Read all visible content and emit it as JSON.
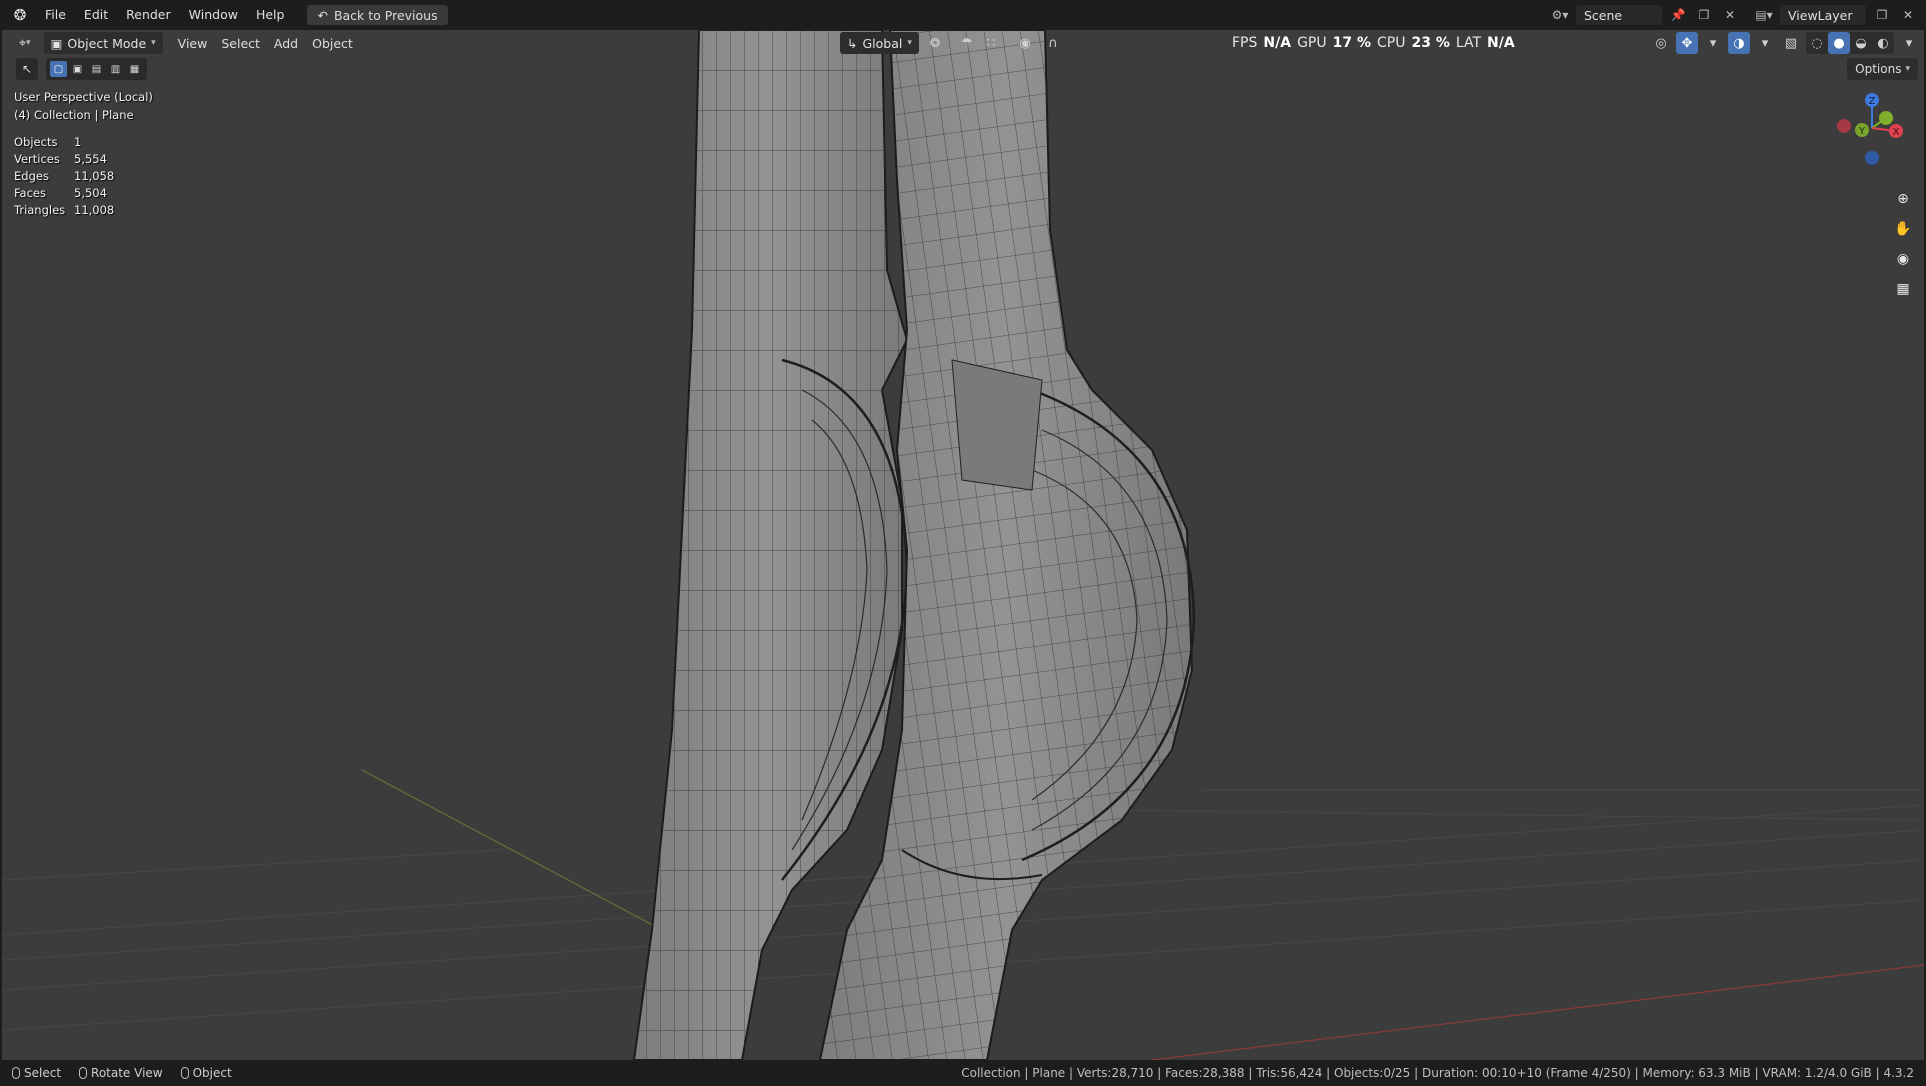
{
  "menu": {
    "items": [
      "File",
      "Edit",
      "Render",
      "Window",
      "Help"
    ],
    "back_button": "Back to Previous"
  },
  "top_right": {
    "scene_label": "Scene",
    "viewlayer_label": "ViewLayer"
  },
  "viewport_header": {
    "mode": "Object Mode",
    "menus": [
      "View",
      "Select",
      "Add",
      "Object"
    ],
    "transform_orientation": "Global",
    "perf": {
      "fps_label": "FPS",
      "fps_value": "N/A",
      "gpu_label": "GPU",
      "gpu_value": "17 %",
      "cpu_label": "CPU",
      "cpu_value": "23 %",
      "lat_label": "LAT",
      "lat_value": "N/A"
    },
    "options_label": "Options"
  },
  "overlay": {
    "view_name": "User Perspective (Local)",
    "collection": "(4) Collection | Plane",
    "stats": [
      {
        "label": "Objects",
        "value": "1"
      },
      {
        "label": "Vertices",
        "value": "5,554"
      },
      {
        "label": "Edges",
        "value": "11,058"
      },
      {
        "label": "Faces",
        "value": "5,504"
      },
      {
        "label": "Triangles",
        "value": "11,008"
      }
    ]
  },
  "gizmo": {
    "z": "Z",
    "y": "Y",
    "x": "X",
    "colors": {
      "x": "#e0424e",
      "y": "#7fb02c",
      "z": "#3d7be0"
    }
  },
  "status": {
    "hints": [
      "Select",
      "Rotate View",
      "Object"
    ],
    "info": "Collection | Plane | Verts:28,710 | Faces:28,388 | Tris:56,424 | Objects:0/25 | Duration: 00:10+10 (Frame 4/250) | Memory: 63.3 MiB | VRAM: 1.2/4.0 GiB | 4.3.2"
  },
  "colors": {
    "viewport_bg": "#3c3c3c",
    "mesh_fill": "#8a8a8a",
    "wire": "#222222",
    "accent": "#4772b3"
  }
}
